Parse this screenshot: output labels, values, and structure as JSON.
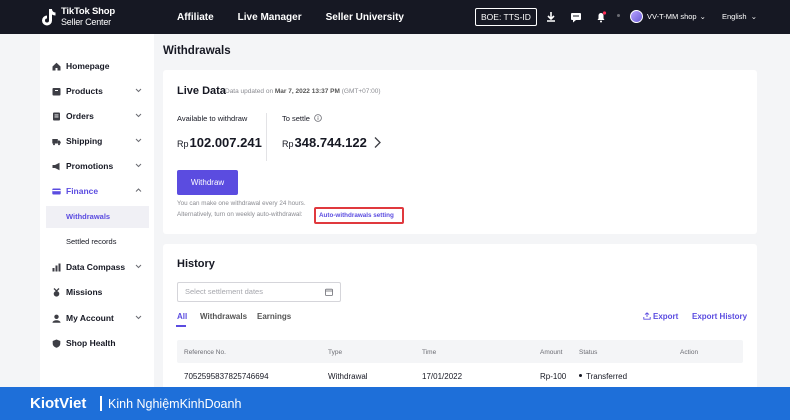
{
  "topbar": {
    "logo_title": "TikTok Shop",
    "logo_sub": "Seller Center",
    "nav": [
      "Affiliate",
      "Live Manager",
      "Seller University"
    ],
    "boe": "BOE: TTS-ID",
    "user": "VV-T-MM shop",
    "language": "English",
    "icons": [
      "download-icon",
      "chat-icon",
      "bell-icon"
    ],
    "notification_color": "#fe2c55"
  },
  "sidebar": {
    "items": [
      {
        "label": "Homepage",
        "icon": "home-icon"
      },
      {
        "label": "Products",
        "icon": "box-icon"
      },
      {
        "label": "Orders",
        "icon": "orders-icon"
      },
      {
        "label": "Shipping",
        "icon": "truck-icon"
      },
      {
        "label": "Promotions",
        "icon": "megaphone-icon"
      },
      {
        "label": "Finance",
        "icon": "card-icon"
      },
      {
        "label": "Data Compass",
        "icon": "chart-icon"
      },
      {
        "label": "Missions",
        "icon": "medal-icon"
      },
      {
        "label": "My Account",
        "icon": "user-icon"
      },
      {
        "label": "Shop Health",
        "icon": "shield-icon"
      }
    ],
    "finance_sub": [
      "Withdrawals",
      "Settled records"
    ],
    "active_color": "#5b4ce0"
  },
  "main": {
    "page_title": "Withdrawals",
    "live": {
      "title": "Live Data",
      "updated_prefix": "Data updated on ",
      "updated_date": "Mar 7, 2022 13:37 PM",
      "updated_tz": " (GMT+07:00)",
      "available_label": "Available to withdraw",
      "available_currency": "Rp",
      "available_amount": "102.007.241",
      "settle_label": "To settle",
      "settle_currency": "Rp",
      "settle_amount": "348.744.122",
      "withdraw_button": "Withdraw",
      "note1": "You can make one withdrawal every 24 hours.",
      "note2": "Alternatively, turn on weekly auto-withdrawal:",
      "auto_link": "Auto-withdrawals setting"
    },
    "history": {
      "title": "History",
      "date_placeholder": "Select settlement dates",
      "tabs": [
        "All",
        "Withdrawals",
        "Earnings"
      ],
      "export": "Export",
      "export_history": "Export History",
      "columns": [
        "Reference No.",
        "Type",
        "Time",
        "Amount",
        "Status",
        "Action"
      ],
      "rows": [
        {
          "ref": "7052595837825746694",
          "type": "Withdrawal",
          "time": "17/01/2022",
          "amount": "Rp-100",
          "status": "Transferred"
        }
      ]
    }
  },
  "banner": {
    "brand": "KiotViet",
    "tagline": "Kinh NghiệmKinhDoanh",
    "color": "#1e6fd9"
  }
}
